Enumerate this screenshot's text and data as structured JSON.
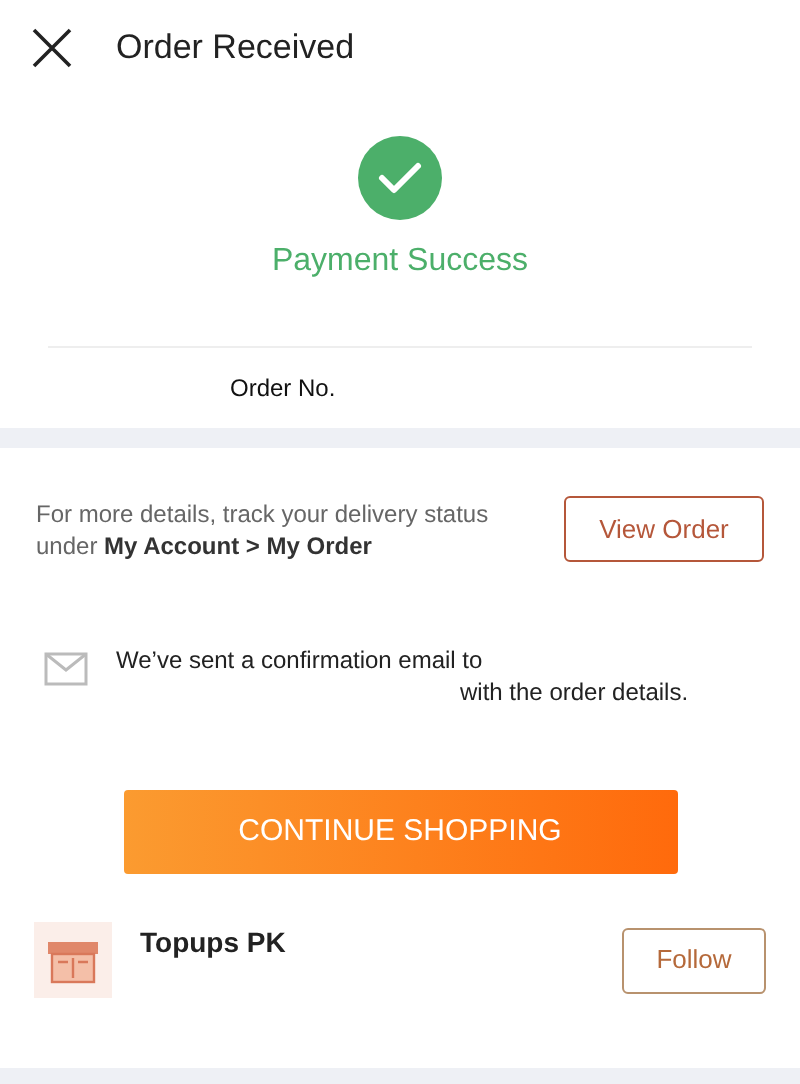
{
  "header": {
    "title": "Order Received"
  },
  "status": {
    "message": "Payment Success",
    "order_label": "Order No."
  },
  "tracking": {
    "text": "For more details, track your delivery status under **My Account > My Order**",
    "button": "View Order"
  },
  "email": {
    "line_1": "We’ve sent a confirmation email to",
    "line_2": "with the order details."
  },
  "continue_button": "CONTINUE SHOPPING",
  "store": {
    "name": "Topups PK",
    "button": "Follow"
  }
}
